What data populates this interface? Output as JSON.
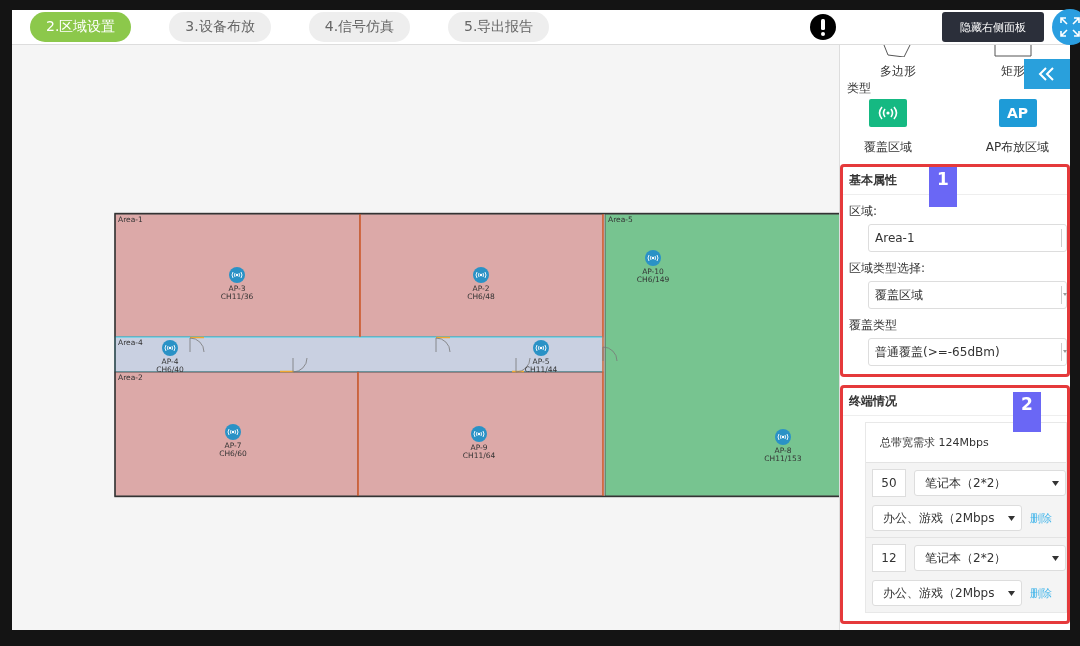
{
  "tabs": [
    {
      "label": "2.区域设置",
      "selected": true
    },
    {
      "label": "3.设备布放",
      "selected": false
    },
    {
      "label": "4.信号仿真",
      "selected": false
    },
    {
      "label": "5.导出报告",
      "selected": false
    }
  ],
  "hide_panel_button": "隐藏右侧面板",
  "floor_plan": {
    "rooms": [
      {
        "label": "Area-1",
        "kind": "room",
        "color": "#dca9a8"
      },
      {
        "kind": "room",
        "color": "#dca9a8"
      },
      {
        "label": "Area-4",
        "kind": "corridor",
        "color": "#c9d0e1"
      },
      {
        "label": "Area-2",
        "kind": "room",
        "color": "#dca9a8"
      },
      {
        "kind": "room",
        "color": "#dca9a8"
      },
      {
        "label": "Area-5",
        "kind": "room",
        "color": "#77c490"
      }
    ],
    "aps": [
      {
        "name": "AP-3",
        "channel": "CH11/36"
      },
      {
        "name": "AP-2",
        "channel": "CH6/48"
      },
      {
        "name": "AP-4",
        "channel": "CH6/40"
      },
      {
        "name": "AP-5",
        "channel": "CH11/44"
      },
      {
        "name": "AP-7",
        "channel": "CH6/60"
      },
      {
        "name": "AP-9",
        "channel": "CH11/64"
      },
      {
        "name": "AP-10",
        "channel": "CH6/149"
      },
      {
        "name": "AP-8",
        "channel": "CH11/153"
      }
    ]
  },
  "panel": {
    "shape_tools": [
      {
        "label": "多边形",
        "kind": "polygon"
      },
      {
        "label": "矩形",
        "kind": "rectangle"
      }
    ],
    "type_label": "类型",
    "area_types": [
      {
        "label": "覆盖区域",
        "kind": "coverage"
      },
      {
        "label": "AP布放区域",
        "kind": "ap",
        "icon_text": "AP"
      }
    ],
    "basic": {
      "title": "基本属性",
      "badge": "1",
      "fields": [
        {
          "label": "区域:",
          "value": "Area-1",
          "kind": "input"
        },
        {
          "label": "区域类型选择:",
          "value": "覆盖区域",
          "kind": "select"
        },
        {
          "label": "覆盖类型",
          "value": "普通覆盖(>=-65dBm)",
          "kind": "select"
        }
      ]
    },
    "terminals": {
      "title": "终端情况",
      "badge": "2",
      "total": "总带宽需求 124Mbps",
      "rows": [
        {
          "count": "50",
          "device": "笔记本（2*2）",
          "usage": "办公、游戏（2Mbps",
          "delete": "删除"
        },
        {
          "count": "12",
          "device": "笔记本（2*2）",
          "usage": "办公、游戏（2Mbps",
          "delete": "删除"
        }
      ]
    }
  }
}
